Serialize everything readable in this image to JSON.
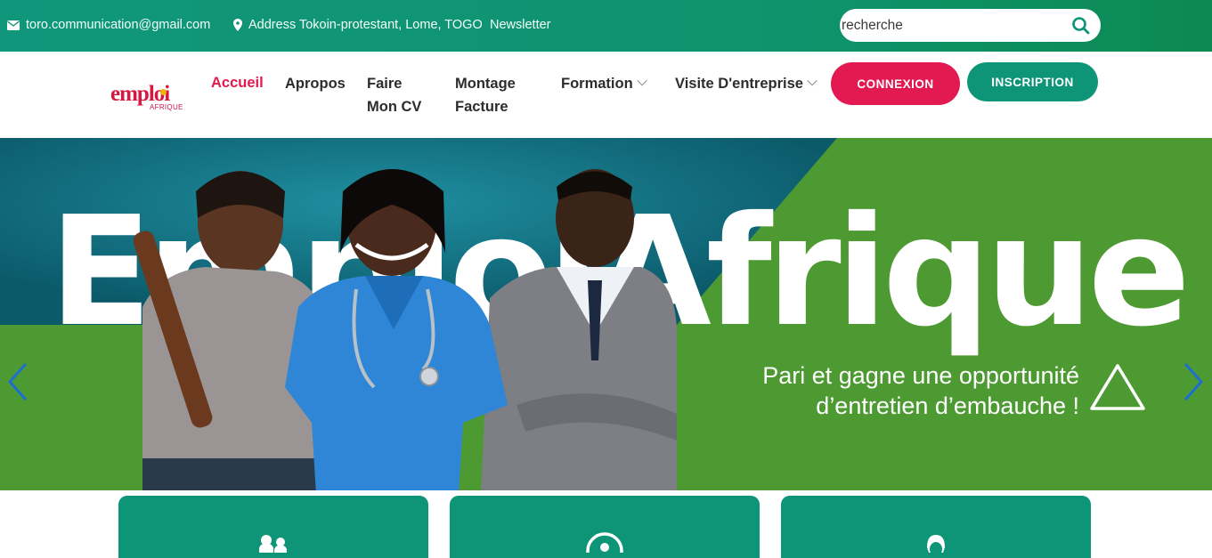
{
  "topbar": {
    "email": "toro.communication@gmail.com",
    "address": "Address Tokoin-protestant, Lome, TOGO",
    "newsletter": "Newsletter",
    "search_placeholder": "recherche"
  },
  "logo": {
    "word": "emploi",
    "sub": "AFRIQUE"
  },
  "nav": {
    "items": [
      {
        "label": "Accueil"
      },
      {
        "label": "Apropos"
      },
      {
        "line1": "Faire",
        "line2": "Mon CV"
      },
      {
        "line1": "Montage",
        "line2": "Facture"
      },
      {
        "label": "Formation"
      },
      {
        "label": "Visite D'entreprise"
      }
    ],
    "connexion": "CONNEXION",
    "inscription": "INSCRIPTION"
  },
  "hero": {
    "title": "EmploiAfrique",
    "tagline_line1": "Pari et gagne une opportunité",
    "tagline_line2": "d’entretien d’embauche !"
  },
  "colors": {
    "primary_green": "#0e9577",
    "accent_red": "#e21a51",
    "hero_green": "#4e9a32",
    "hero_teal": "#0f6a78"
  },
  "icons": {
    "email": "envelope-icon",
    "address": "map-pin-icon",
    "search": "search-icon",
    "slider_prev": "chevron-left-icon",
    "slider_next": "chevron-right-icon"
  }
}
